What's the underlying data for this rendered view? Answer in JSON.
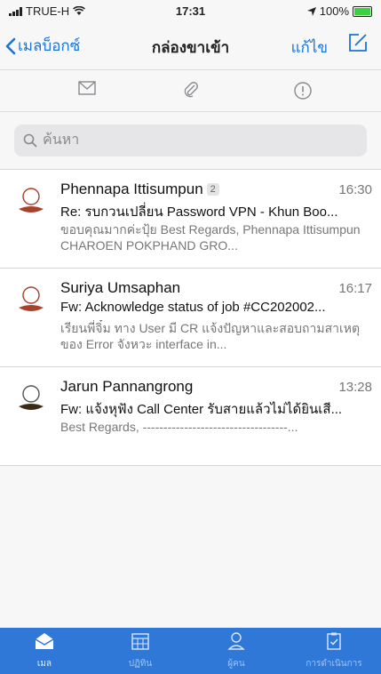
{
  "status_bar": {
    "carrier": "TRUE-H",
    "time": "17:31",
    "battery": "100%",
    "battery_color": "#3dd13d"
  },
  "nav": {
    "back_label": "เมลบ็อกซ์",
    "title": "กล่องขาเข้า",
    "edit_label": "แก้ไข",
    "accent_color": "#1a73d9"
  },
  "filters": [
    "mail-icon",
    "attachment-icon",
    "important-icon"
  ],
  "search": {
    "placeholder": "ค้นหา"
  },
  "messages": [
    {
      "sender": "Phennapa Ittisumpun",
      "count": "2",
      "time": "16:30",
      "subject": "Re: รบกวนเปลี่ยน Password VPN  - Khun Boo...",
      "preview": "ขอบคุณมากค่ะปุ้ย Best Regards, Phennapa Ittisumpun CHAROEN POKPHAND GRO...",
      "avatar_color": "#a7412b"
    },
    {
      "sender": "Suriya Umsaphan",
      "time": "16:17",
      "subject": "Fw: Acknowledge status of job #CC202002...",
      "preview": "เรียนพี่จิ๋ม ทาง User มี CR แจ้งปัญหาและสอบถามสาเหตุของ Error จังหวะ interface in...",
      "avatar_color": "#a7412b"
    },
    {
      "sender": "Jarun Pannangrong",
      "time": "13:28",
      "subject": "Fw: แจ้งหุฟัง Call Center รับสายแล้วไม่ได้ยินเสี...",
      "preview": "Best Regards, -----------------------------------...",
      "avatar_color": "#3b2a18"
    }
  ],
  "tabs": [
    {
      "label": "เมล",
      "icon": "mail-icon",
      "active": true
    },
    {
      "label": "ปฏิทิน",
      "icon": "calendar-icon"
    },
    {
      "label": "ผู้คน",
      "icon": "person-icon"
    },
    {
      "label": "การดำเนินการ",
      "icon": "clipboard-icon"
    }
  ],
  "tabbar_color": "#2f78d8"
}
